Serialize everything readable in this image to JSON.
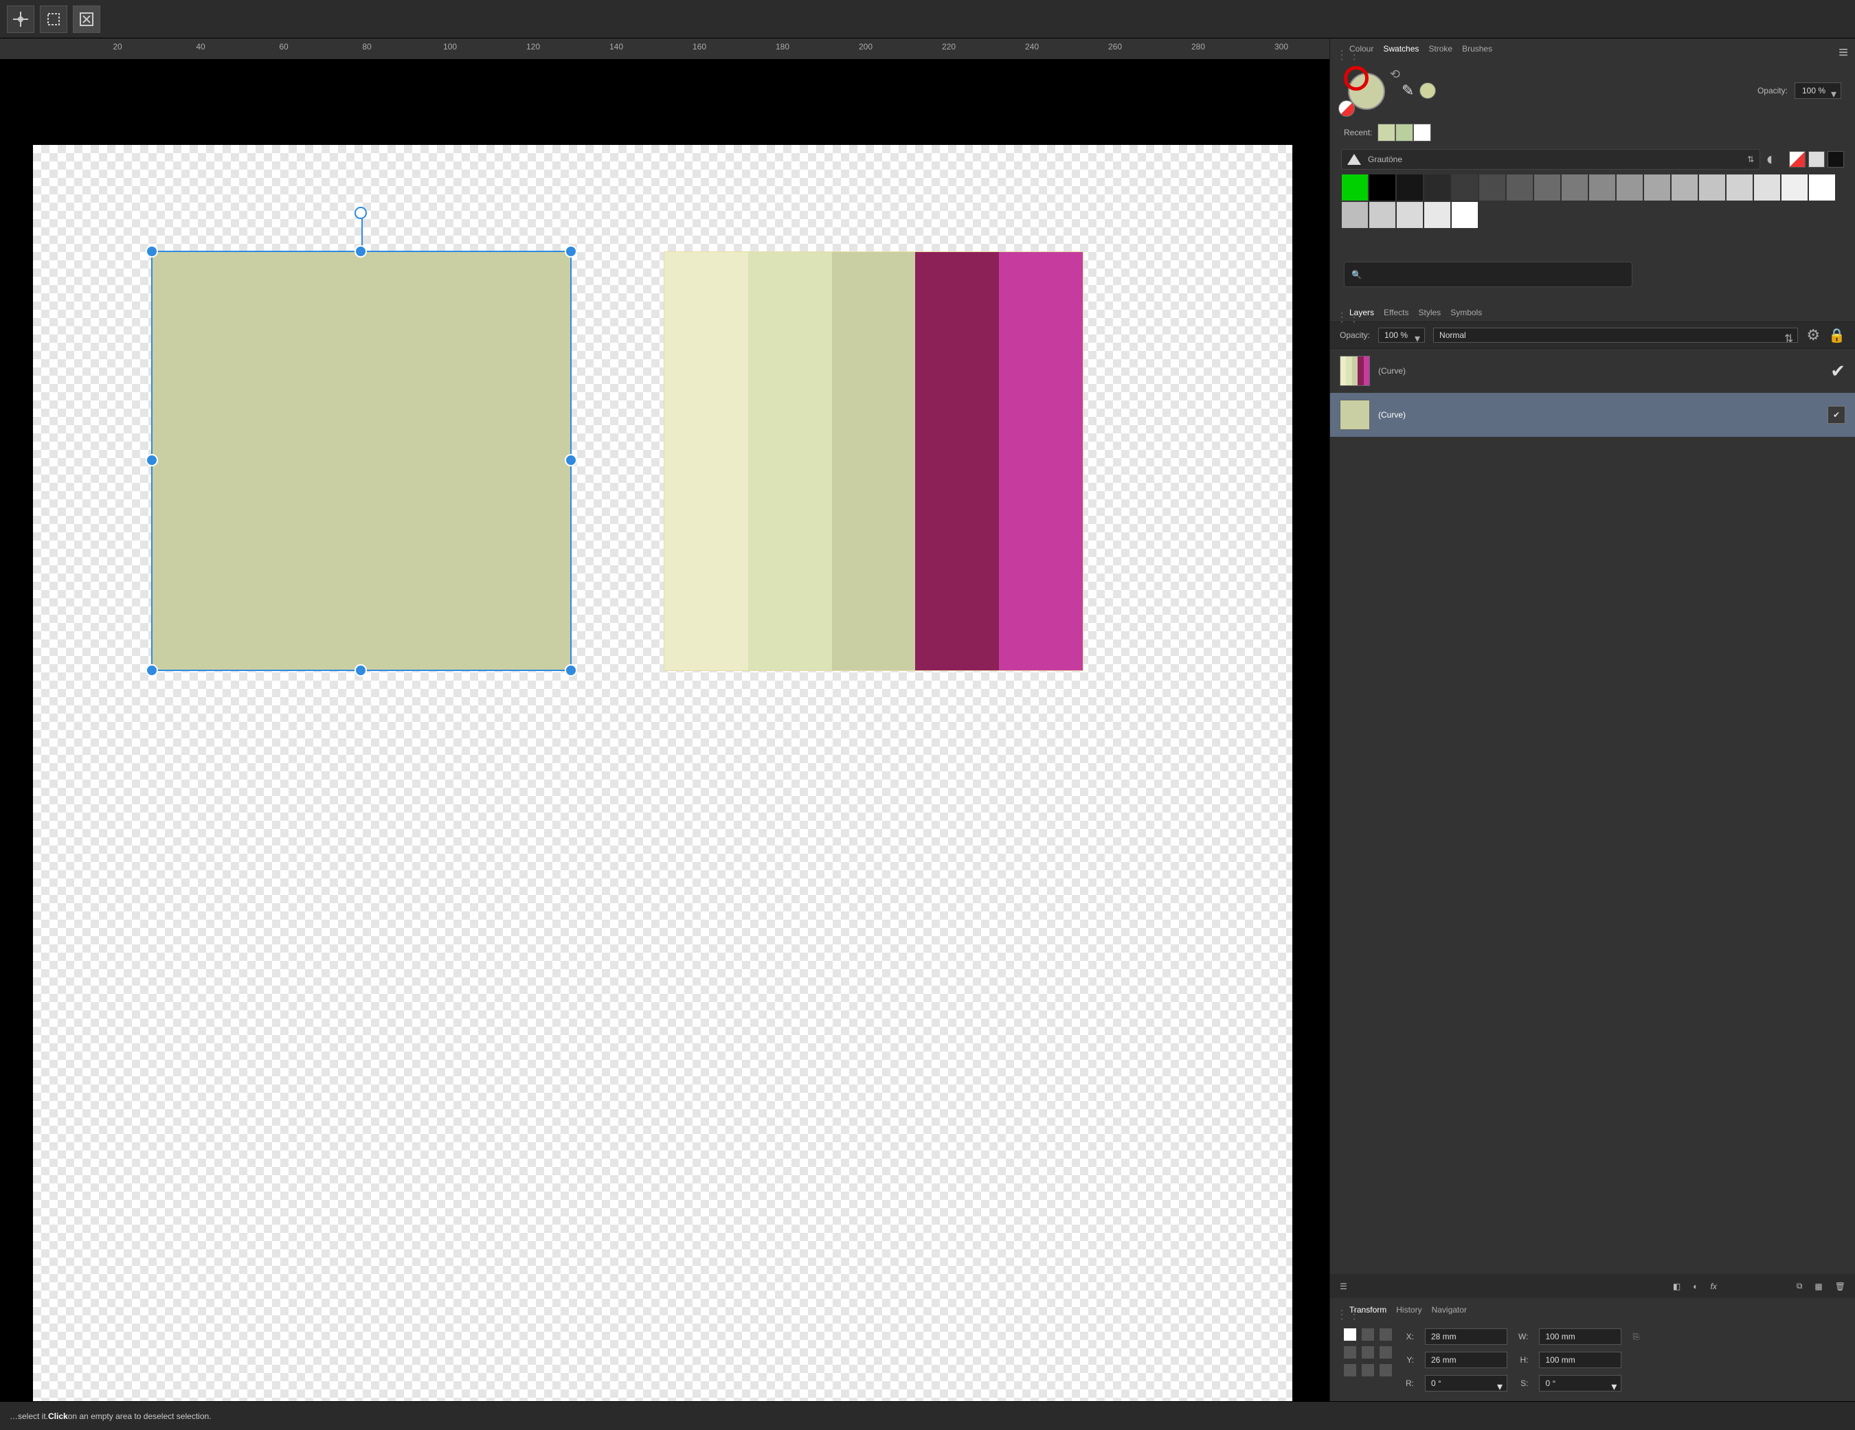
{
  "toolbar": {
    "snap_label": "snap-target",
    "snap_selection": "snap-to-selection",
    "snap_transform": "transform-snap"
  },
  "ruler": {
    "ticks": [
      20,
      40,
      60,
      80,
      100,
      120,
      140,
      160,
      180,
      200,
      220,
      240,
      260,
      280,
      300
    ]
  },
  "panels": {
    "swatches_tabs": [
      "Colour",
      "Swatches",
      "Stroke",
      "Brushes"
    ],
    "swatches_active": "Swatches"
  },
  "swatches": {
    "opacity_label": "Opacity:",
    "opacity_value": "100 %",
    "recent_label": "Recent:",
    "recent_colours": [
      "#cbd7a8",
      "#b9cf9d",
      "#ffffff"
    ],
    "palette_name": "Grautöne",
    "row1": [
      "#00d000",
      "#000000",
      "#161616",
      "#2a2a2a",
      "#3b3b3b",
      "#4b4b4b",
      "#5b5b5b",
      "#6b6b6b",
      "#7a7a7a",
      "#898989",
      "#989898",
      "#a7a7a7",
      "#b5b5b5",
      "#c4c4c4",
      "#d2d2d2",
      "#e0e0e0",
      "#efefef",
      "#ffffff"
    ],
    "row2": [
      "#bdbdbd",
      "#cccccc",
      "#dadada",
      "#e8e8e8",
      "#ffffff"
    ],
    "search_placeholder": ""
  },
  "layers": {
    "tabs": [
      "Layers",
      "Effects",
      "Styles",
      "Symbols"
    ],
    "active": "Layers",
    "opacity_label": "Opacity:",
    "opacity_value": "100 %",
    "blend_mode": "Normal",
    "items": [
      {
        "name": "(Curve)",
        "selected": false,
        "thumb": [
          "#ecedc8",
          "#dce3b6",
          "#cacfa3",
          "#8c2158",
          "#c53c9e"
        ],
        "checked": true,
        "check_style": "tick"
      },
      {
        "name": "(Curve)",
        "selected": true,
        "thumb": [
          "#cacfa3"
        ],
        "checked": true,
        "check_style": "box"
      }
    ]
  },
  "transform": {
    "tabs": [
      "Transform",
      "History",
      "Navigator"
    ],
    "active": "Transform",
    "x_label": "X:",
    "x_value": "28 mm",
    "y_label": "Y:",
    "y_value": "26 mm",
    "w_label": "W:",
    "w_value": "100 mm",
    "h_label": "H:",
    "h_value": "100 mm",
    "r_label": "R:",
    "r_value": "0 °",
    "s_label": "S:",
    "s_value": "0 °"
  },
  "status": {
    "prefix": "…select it. ",
    "bold": "Click",
    "suffix": " on an empty area to deselect selection."
  },
  "artboard": {
    "stripes": [
      "#ecedc8",
      "#dce3b6",
      "#cacfa3",
      "#8c2158",
      "#c53c9e"
    ]
  }
}
